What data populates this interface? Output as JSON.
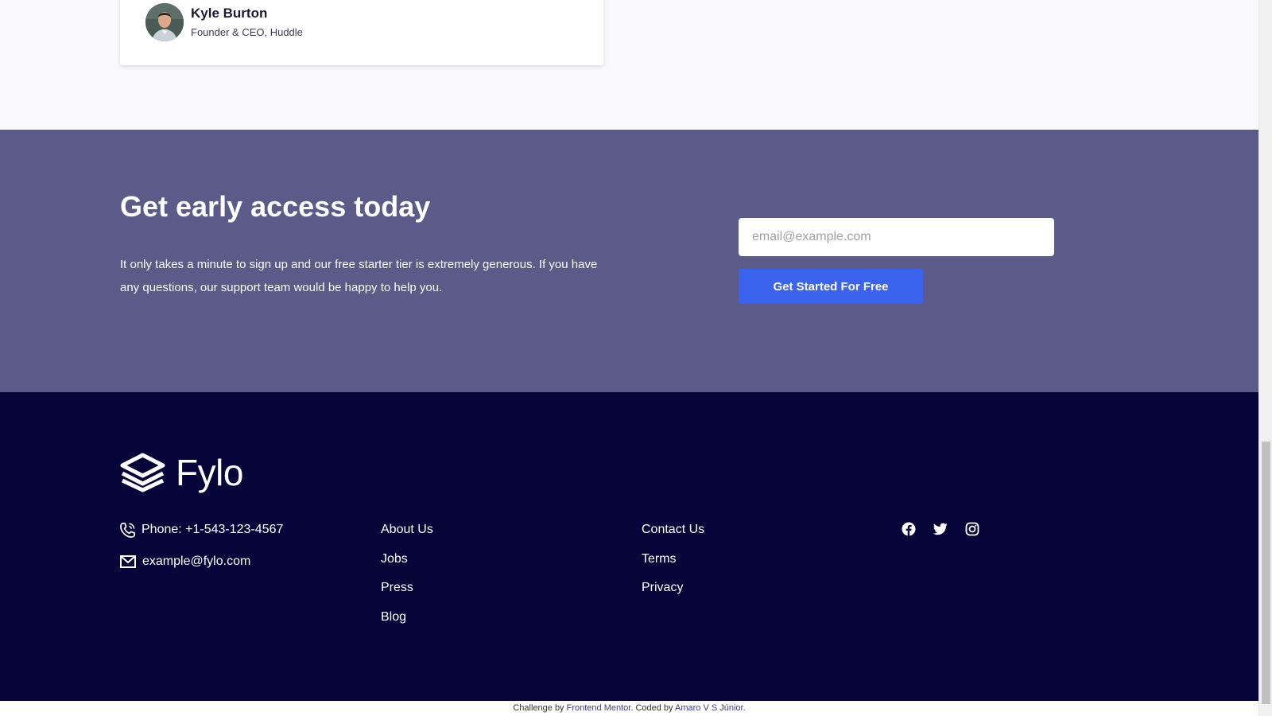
{
  "testimonial": {
    "name": "Kyle Burton",
    "role": "Founder & CEO, Huddle"
  },
  "access": {
    "title": "Get early access today",
    "text": "It only takes a minute to sign up and our free starter tier is extremely generous. If you have any questions, our support team would be happy to help you.",
    "email_placeholder": "email@example.com",
    "button_label": "Get Started For Free"
  },
  "footer": {
    "logo_text": "Fylo",
    "phone": "Phone: +1-543-123-4567",
    "email": "example@fylo.com",
    "links_col1": [
      "About Us",
      "Jobs",
      "Press",
      "Blog"
    ],
    "links_col2": [
      "Contact Us",
      "Terms",
      "Privacy"
    ],
    "social_icons": [
      "facebook-icon",
      "twitter-icon",
      "instagram-icon"
    ]
  },
  "attribution": {
    "prefix": "Challenge by ",
    "challenge_link": "Frontend Mentor",
    "middle": ". Coded by ",
    "author_link": "Amaro V S Júnior",
    "suffix": "."
  },
  "colors": {
    "access_bg": "#5b5a89",
    "footer_bg": "#070439",
    "cta": "#3a63f0",
    "page_bg": "#f9f9fc"
  }
}
